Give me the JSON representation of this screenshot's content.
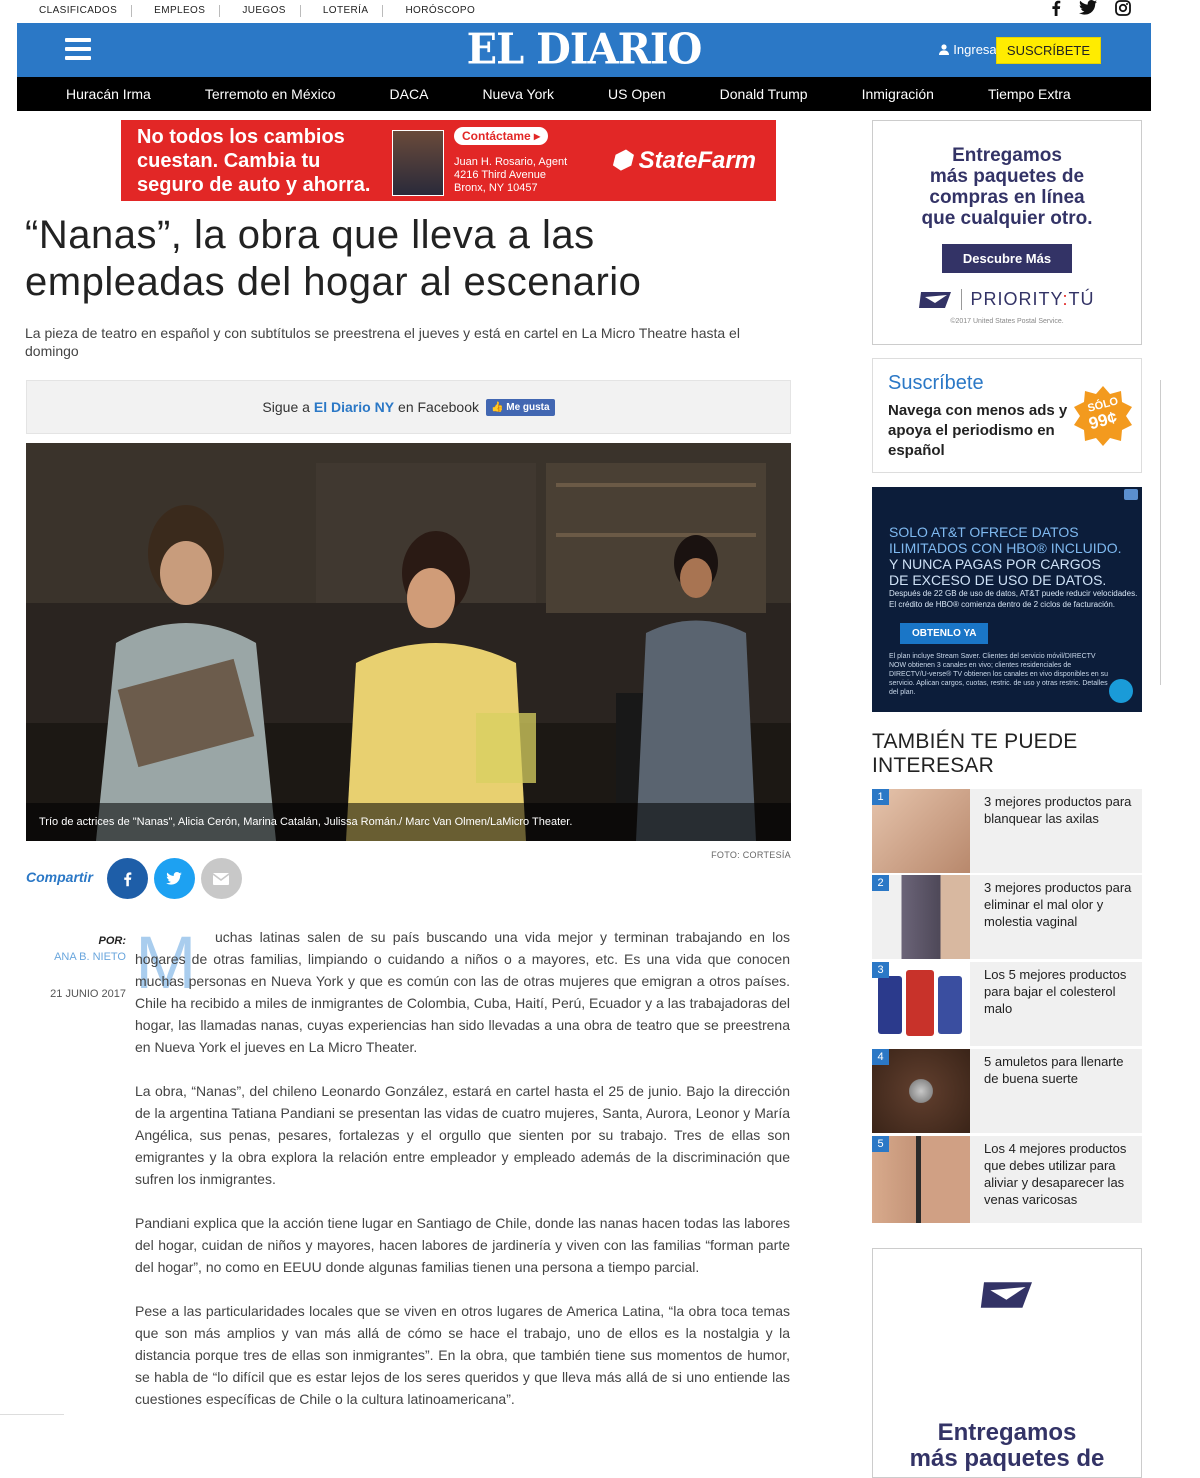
{
  "top_links": [
    "CLASIFICADOS",
    "EMPLEOS",
    "JUEGOS",
    "LOTERÍA",
    "HORÓSCOPO"
  ],
  "social_icons": [
    "facebook-icon",
    "twitter-icon",
    "instagram-icon"
  ],
  "masthead": {
    "logo": "EL DIARIO",
    "login": "Ingresar",
    "subscribe": "SUSCRÍBETE",
    "brand_color": "#2b78c6"
  },
  "nav": [
    "Huracán Irma",
    "Terremoto en México",
    "DACA",
    "Nueva York",
    "US Open",
    "Donald Trump",
    "Inmigración",
    "Tiempo Extra"
  ],
  "top_ad": {
    "line1": "No todos los cambios",
    "line2": "cuestan. Cambia tu",
    "line3": "seguro de auto y ahorra.",
    "contact": "Contáctame ▸",
    "agent_name": "Juan H. Rosario, Agent",
    "agent_addr1": "4216 Third Avenue",
    "agent_addr2": "Bronx, NY 10457",
    "brand": "StateFarm"
  },
  "article": {
    "headline": "“Nanas”, la obra que lleva a las empleadas del hogar al escenario",
    "subhead": "La pieza de teatro en español y con subtítulos se preestrena el jueves y está en cartel en La Micro Theatre hasta el domingo",
    "fb_prefix": "Sigue a",
    "fb_name": "El Diario NY",
    "fb_suffix": "en Facebook",
    "fb_like": "Me gusta",
    "photo_caption": "Trío de actrices de \"Nanas\", Alicia Cerón, Marina Catalán, Julissa Román./ Marc Van Olmen/LaMicro Theater.",
    "photo_credit": "FOTO: CORTESÍA",
    "share_label": "Compartir",
    "byline_por": "POR:",
    "byline_author": "ANA B. NIETO",
    "byline_date": "21 JUNIO 2017",
    "dropcap": "M",
    "paragraphs": [
      "uchas latinas salen de su país buscando una vida mejor y terminan trabajando en los hogares de otras familias, limpiando o cuidando a niños o a mayores, etc. Es una vida que conocen muchas personas en Nueva York y que es común con las de otras mujeres que emigran a otros países. Chile ha recibido a miles de inmigrantes de Colombia, Cuba, Haití, Perú, Ecuador y a las trabajadoras del hogar, las llamadas nanas, cuyas experiencias han sido llevadas a una obra de teatro que se preestrena en Nueva York el jueves en La Micro Theater.",
      "La obra, “Nanas”, del chileno Leonardo González, estará en cartel hasta el 25 de junio. Bajo la dirección de la argentina Tatiana Pandiani se presentan las vidas de cuatro mujeres, Santa, Aurora, Leonor y María Angélica, sus penas, pesares, fortalezas y el orgullo que sienten por su trabajo. Tres de ellas son emigrantes y la obra explora la relación entre empleador y empleado además de la discriminación que sufren los inmigrantes.",
      "Pandiani explica que la acción tiene lugar en Santiago de Chile, donde las nanas hacen todas las labores del hogar, cuidan de niños y mayores, hacen labores de jardinería y viven con las familias “forman parte del hogar”, no como en EEUU donde algunas familias tienen una persona a tiempo parcial.",
      "Pese a las particularidades locales que se viven en otros lugares de America Latina, “la obra toca temas que son más amplios y van más allá de cómo se hace el trabajo, uno de ellos es la nostalgia y la distancia porque tres de ellas son inmigrantes”. En la obra, que también tiene sus momentos de humor, se habla de “lo difícil que es estar lejos de los seres queridos y que lleva más allá de si uno entiende las cuestiones específicas de Chile o la cultura latinoamericana”."
    ]
  },
  "side_ad_usps": {
    "line1": "Entregamos",
    "line2": "más paquetes de",
    "line3": "compras en línea",
    "line4": "que cualquier otro.",
    "button": "Descubre Más",
    "brand": "PRIORITY",
    "brand_sep": ":",
    "brand_end": "TÚ",
    "fineprint": "©2017 United States Postal Service."
  },
  "side_subscribe": {
    "title": "Suscríbete",
    "text": "Navega con menos ads y apoya el periodismo en español",
    "badge_line1": "SÓLO",
    "badge_line2": "99¢"
  },
  "side_ad_att": {
    "line1": "SOLO AT&T OFRECE DATOS",
    "line2": "ILIMITADOS CON HBO® INCLUIDO.",
    "line3": "Y NUNCA PAGAS POR CARGOS",
    "line4": "DE EXCESO DE USO DE DATOS.",
    "fine": "Después de 22 GB de uso de datos, AT&T puede reducir velocidades. El crédito de HBO® comienza dentro de 2 ciclos de facturación.",
    "cta": "OBTENLO YA",
    "fine2": "El plan incluye Stream Saver. Clientes del servicio móvil/DIRECTV NOW obtienen 3 canales en vivo; clientes residenciales de DIRECTV/U-verse® TV obtienen los canales en vivo disponibles en su servicio. Aplican cargos, cuotas, restric. de uso y otras restric. Detalles del plan."
  },
  "recommendations": {
    "title": "TAMBIÉN TE PUEDE INTERESAR",
    "items": [
      {
        "num": "1",
        "text": "3 mejores productos para blanquear las axilas"
      },
      {
        "num": "2",
        "text": "3 mejores productos para eliminar el mal olor y molestia vaginal"
      },
      {
        "num": "3",
        "text": "Los 5 mejores productos para bajar el colesterol malo"
      },
      {
        "num": "4",
        "text": "5 amuletos para llenarte de buena suerte"
      },
      {
        "num": "5",
        "text": "Los 4 mejores productos que debes utilizar para aliviar y desaparecer las venas varicosas"
      }
    ]
  },
  "side_ad_usps2": {
    "line1": "Entregamos",
    "line2": "más paquetes de"
  }
}
